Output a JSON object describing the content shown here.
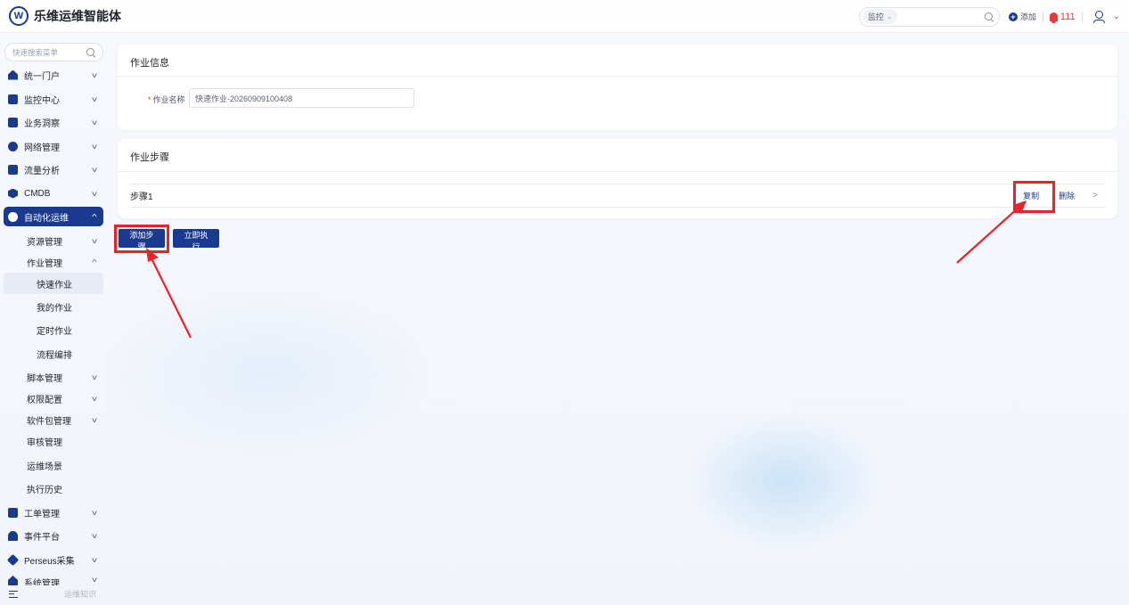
{
  "header": {
    "logo_letter": "W",
    "app_title": "乐维运维智能体",
    "search_scope": "监控",
    "add_label": "添加",
    "notification_count": "111"
  },
  "sidebar": {
    "search_placeholder": "快速搜索菜单",
    "items": [
      {
        "label": "统一门户"
      },
      {
        "label": "监控中心"
      },
      {
        "label": "业务洞察"
      },
      {
        "label": "网络管理"
      },
      {
        "label": "流量分析"
      },
      {
        "label": "CMDB"
      },
      {
        "label": "自动化运维"
      },
      {
        "label": "资源管理"
      },
      {
        "label": "作业管理"
      },
      {
        "label": "快速作业"
      },
      {
        "label": "我的作业"
      },
      {
        "label": "定时作业"
      },
      {
        "label": "流程编排"
      },
      {
        "label": "脚本管理"
      },
      {
        "label": "权限配置"
      },
      {
        "label": "软件包管理"
      },
      {
        "label": "审核管理"
      },
      {
        "label": "运维场景"
      },
      {
        "label": "执行历史"
      },
      {
        "label": "工单管理"
      },
      {
        "label": "事件平台"
      },
      {
        "label": "Perseus采集"
      },
      {
        "label": "系统管理"
      }
    ],
    "bottom_link": "运维知识"
  },
  "job_info": {
    "title": "作业信息",
    "name_label": "作业名称",
    "name_value": "快速作业-20260909100408"
  },
  "job_steps": {
    "title": "作业步骤",
    "steps": [
      {
        "name": "步骤1",
        "copy_label": "复制",
        "delete_label": "删除"
      }
    ]
  },
  "actions": {
    "add_step": "添加步骤",
    "execute_now": "立即执行"
  },
  "colors": {
    "brand": "#1a3a8f",
    "highlight": "#e8232b",
    "alert": "#e23b3b"
  }
}
